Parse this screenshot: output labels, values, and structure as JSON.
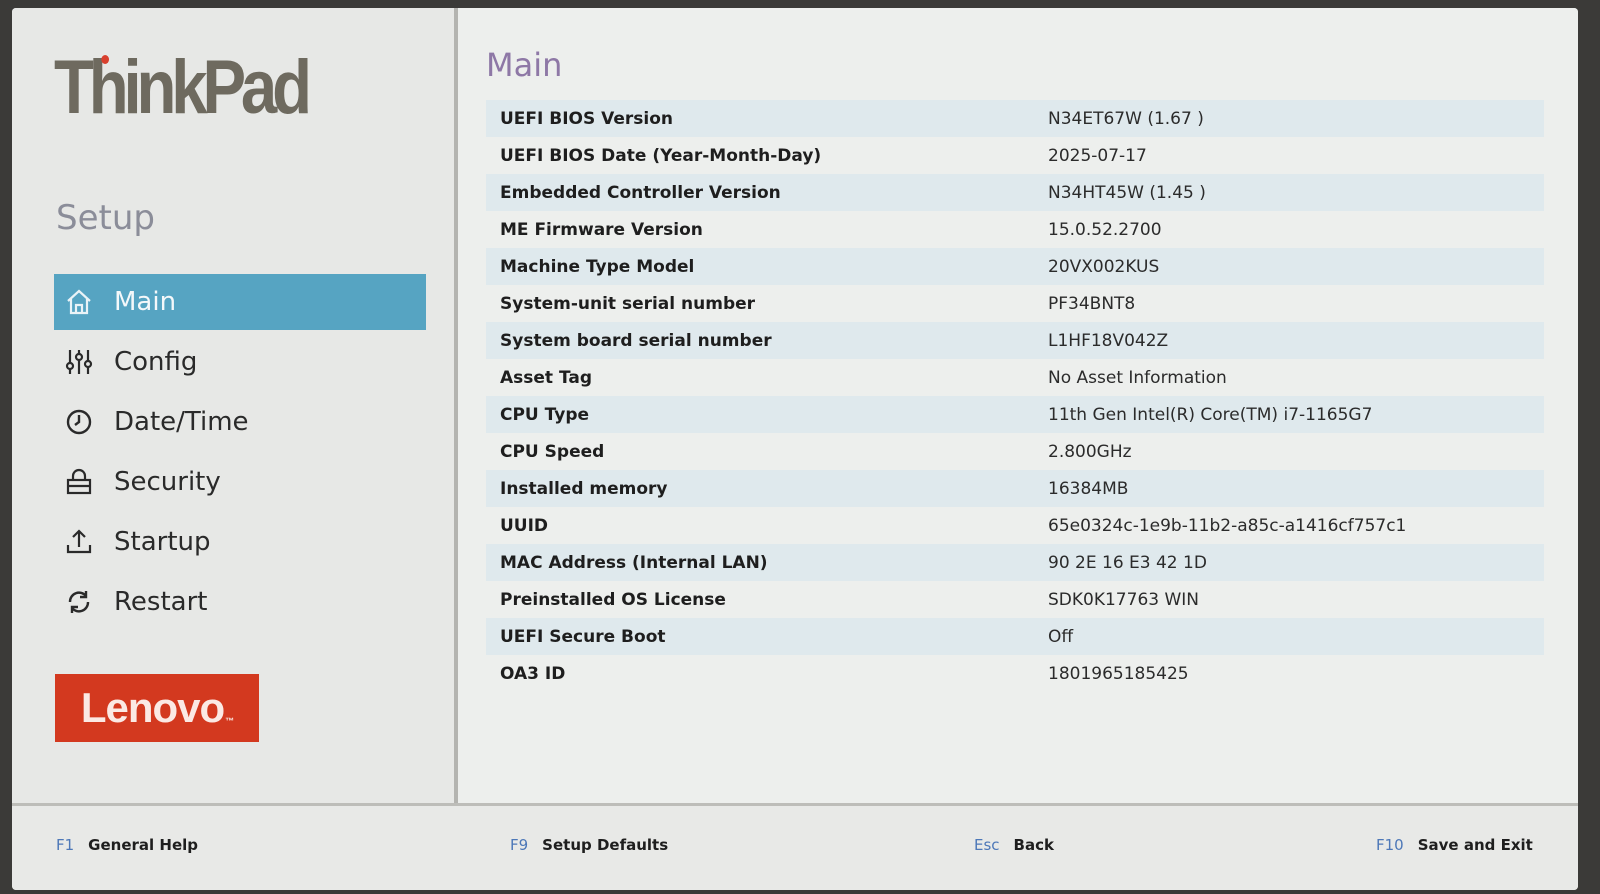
{
  "brand": {
    "thinkpad": "ThinkPad",
    "lenovo": "Lenovo",
    "lenovo_mark": "™"
  },
  "sidebar": {
    "title": "Setup",
    "items": [
      {
        "label": "Main",
        "icon": "home-icon",
        "active": true
      },
      {
        "label": "Config",
        "icon": "sliders-icon",
        "active": false
      },
      {
        "label": "Date/Time",
        "icon": "clock-icon",
        "active": false
      },
      {
        "label": "Security",
        "icon": "lock-icon",
        "active": false
      },
      {
        "label": "Startup",
        "icon": "upload-icon",
        "active": false
      },
      {
        "label": "Restart",
        "icon": "refresh-icon",
        "active": false
      }
    ]
  },
  "main": {
    "title": "Main",
    "rows": [
      {
        "label": "UEFI BIOS Version",
        "value": "N34ET67W (1.67 )"
      },
      {
        "label": "UEFI BIOS Date (Year-Month-Day)",
        "value": "2025-07-17"
      },
      {
        "label": "Embedded Controller Version",
        "value": "N34HT45W (1.45 )"
      },
      {
        "label": "ME Firmware Version",
        "value": "15.0.52.2700"
      },
      {
        "label": "Machine Type Model",
        "value": "20VX002KUS"
      },
      {
        "label": "System-unit serial number",
        "value": "PF34BNT8"
      },
      {
        "label": "System board serial number",
        "value": "L1HF18V042Z"
      },
      {
        "label": "Asset Tag",
        "value": "No Asset Information"
      },
      {
        "label": "CPU Type",
        "value": "11th Gen Intel(R) Core(TM) i7-1165G7"
      },
      {
        "label": "CPU Speed",
        "value": "2.800GHz"
      },
      {
        "label": "Installed memory",
        "value": "16384MB"
      },
      {
        "label": "UUID",
        "value": "65e0324c-1e9b-11b2-a85c-a1416cf757c1"
      },
      {
        "label": "MAC Address (Internal LAN)",
        "value": "90 2E 16 E3 42 1D"
      },
      {
        "label": "Preinstalled OS License",
        "value": "SDK0K17763 WIN"
      },
      {
        "label": "UEFI Secure Boot",
        "value": "Off"
      },
      {
        "label": "OA3 ID",
        "value": "1801965185425"
      }
    ]
  },
  "footer": {
    "help": {
      "key": "F1",
      "action": "General Help"
    },
    "defaults": {
      "key": "F9",
      "action": "Setup Defaults"
    },
    "back": {
      "key": "Esc",
      "action": "Back"
    },
    "save": {
      "key": "F10",
      "action": "Save and Exit"
    }
  },
  "colors": {
    "active_nav": "#56a4c2",
    "title_purple": "#8e78a6",
    "lenovo_red": "#d3391f",
    "fkey_blue": "#4d78b8",
    "row_stripe": "#dfe9ed"
  }
}
